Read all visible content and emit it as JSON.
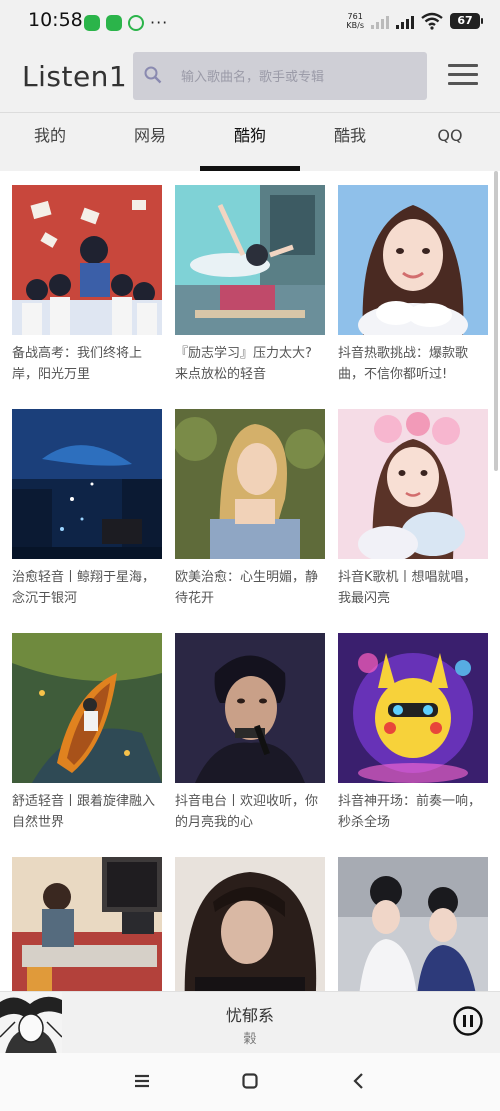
{
  "status_bar": {
    "time": "10:58",
    "notification_dots": "···",
    "net_speed_value": "761",
    "net_speed_unit": "KB/s",
    "battery": "67"
  },
  "header": {
    "app_title": "Listen1",
    "search_placeholder": "输入歌曲名，歌手或专辑",
    "search_value": ""
  },
  "tabs": [
    {
      "label": "我的",
      "active": false
    },
    {
      "label": "网易",
      "active": false
    },
    {
      "label": "酷狗",
      "active": true
    },
    {
      "label": "酷我",
      "active": false
    },
    {
      "label": "QQ",
      "active": false
    }
  ],
  "playlists": [
    {
      "title": "备战高考：我们终将上岸，阳光万里"
    },
    {
      "title": "『励志学习』压力太大? 来点放松的轻音"
    },
    {
      "title": "抖音热歌挑战：爆款歌曲，不信你都听过!"
    },
    {
      "title": "治愈轻音丨鲸翔于星海，念沉于银河"
    },
    {
      "title": "欧美治愈：心生明媚，静待花开"
    },
    {
      "title": "抖音K歌机丨想唱就唱，我最闪亮"
    },
    {
      "title": "舒适轻音丨跟着旋律融入自然世界"
    },
    {
      "title": "抖音电台丨欢迎收听，你的月亮我的心"
    },
    {
      "title": "抖音神开场：前奏一响，秒杀全场"
    },
    {
      "title": ""
    },
    {
      "title": ""
    },
    {
      "title": ""
    }
  ],
  "player": {
    "title": "忧郁系",
    "artist": "榖"
  },
  "colors": {
    "bar_background": "#f1f1f1",
    "search_background": "#cfcfd6",
    "active_tab_indicator": "#111111"
  },
  "icons": {
    "search": "search-icon",
    "menu": "hamburger-menu-icon",
    "pause": "pause-icon",
    "nav_recents": "recents-icon",
    "nav_home": "home-icon",
    "nav_back": "back-icon"
  }
}
